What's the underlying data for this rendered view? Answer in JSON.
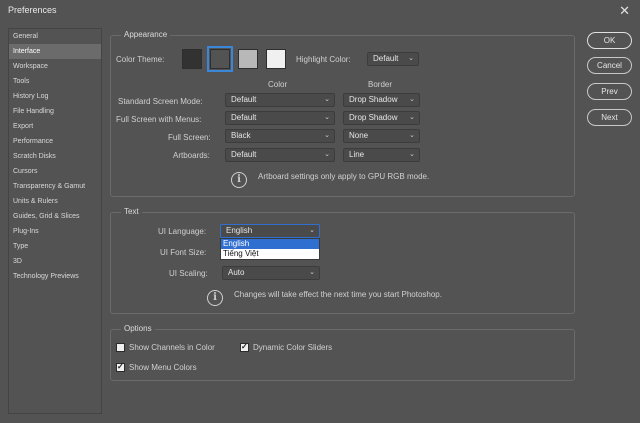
{
  "window": {
    "title": "Preferences",
    "close_glyph": "✕"
  },
  "sidebar": {
    "items": [
      {
        "label": "General"
      },
      {
        "label": "Interface"
      },
      {
        "label": "Workspace"
      },
      {
        "label": "Tools"
      },
      {
        "label": "History Log"
      },
      {
        "label": "File Handling"
      },
      {
        "label": "Export"
      },
      {
        "label": "Performance"
      },
      {
        "label": "Scratch Disks"
      },
      {
        "label": "Cursors"
      },
      {
        "label": "Transparency & Gamut"
      },
      {
        "label": "Units & Rulers"
      },
      {
        "label": "Guides, Grid & Slices"
      },
      {
        "label": "Plug-Ins"
      },
      {
        "label": "Type"
      },
      {
        "label": "3D"
      },
      {
        "label": "Technology Previews"
      }
    ],
    "active_index": 1
  },
  "appearance": {
    "legend": "Appearance",
    "color_theme_label": "Color Theme:",
    "theme_swatches": [
      "#323232",
      "#535353",
      "#b8b8b8",
      "#f0f0f0"
    ],
    "selected_theme_index": 1,
    "highlight_color_label": "Highlight Color:",
    "highlight_color_value": "Default",
    "col_color": "Color",
    "col_border": "Border",
    "rows": [
      {
        "label": "Standard Screen Mode:",
        "color": "Default",
        "border": "Drop Shadow"
      },
      {
        "label": "Full Screen with Menus:",
        "color": "Default",
        "border": "Drop Shadow"
      },
      {
        "label": "Full Screen:",
        "color": "Black",
        "border": "None"
      },
      {
        "label": "Artboards:",
        "color": "Default",
        "border": "Line"
      }
    ],
    "info": "Artboard settings only apply to GPU RGB mode."
  },
  "text": {
    "legend": "Text",
    "ui_language_label": "UI Language:",
    "ui_language_value": "English",
    "ui_font_size_label": "UI Font Size:",
    "ui_scaling_label": "UI Scaling:",
    "ui_scaling_value": "Auto",
    "language_options": [
      "English",
      "Tiếng Việt"
    ],
    "highlighted_option_index": 0,
    "info": "Changes will take effect the next time you start Photoshop."
  },
  "options": {
    "legend": "Options",
    "show_channels_in_color": {
      "label": "Show Channels in Color",
      "checked": false
    },
    "dynamic_color_sliders": {
      "label": "Dynamic Color Sliders",
      "checked": true
    },
    "show_menu_colors": {
      "label": "Show Menu Colors",
      "checked": true
    }
  },
  "buttons": {
    "ok": "OK",
    "cancel": "Cancel",
    "prev": "Prev",
    "next": "Next"
  },
  "icons": {
    "info": "info-icon",
    "chevron": "chevron-down-icon",
    "close": "close-icon"
  },
  "colors": {
    "background": "#535353",
    "highlight_blue": "#2f6fd0",
    "theme_outline": "#3a86d9"
  }
}
